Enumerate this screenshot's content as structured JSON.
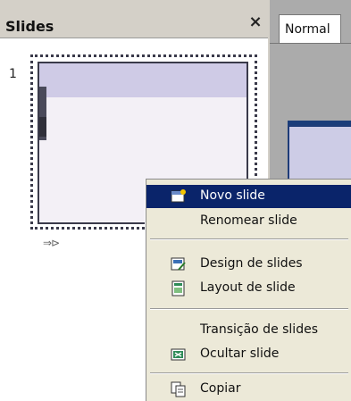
{
  "panel": {
    "title": "Slides",
    "close": "×",
    "slide_number": "1",
    "transition_icon": "⇒⊳"
  },
  "view": {
    "tab_label": "Normal"
  },
  "context_menu": {
    "items": [
      {
        "label": "Novo slide",
        "icon": "new-slide-icon",
        "highlighted": true
      },
      {
        "label": "Renomear slide",
        "icon": ""
      },
      {
        "label": "Design de slides",
        "icon": "slide-design-icon"
      },
      {
        "label": "Layout de slide",
        "icon": "slide-layout-icon"
      },
      {
        "label": "Transição de slides",
        "icon": ""
      },
      {
        "label": "Ocultar slide",
        "icon": "hide-slide-icon"
      },
      {
        "label": "Copiar",
        "icon": "copy-icon"
      }
    ]
  },
  "colors": {
    "highlight": "#0a246a",
    "menu_bg": "#ece9d8",
    "panel_bg": "#d4d0c8"
  }
}
